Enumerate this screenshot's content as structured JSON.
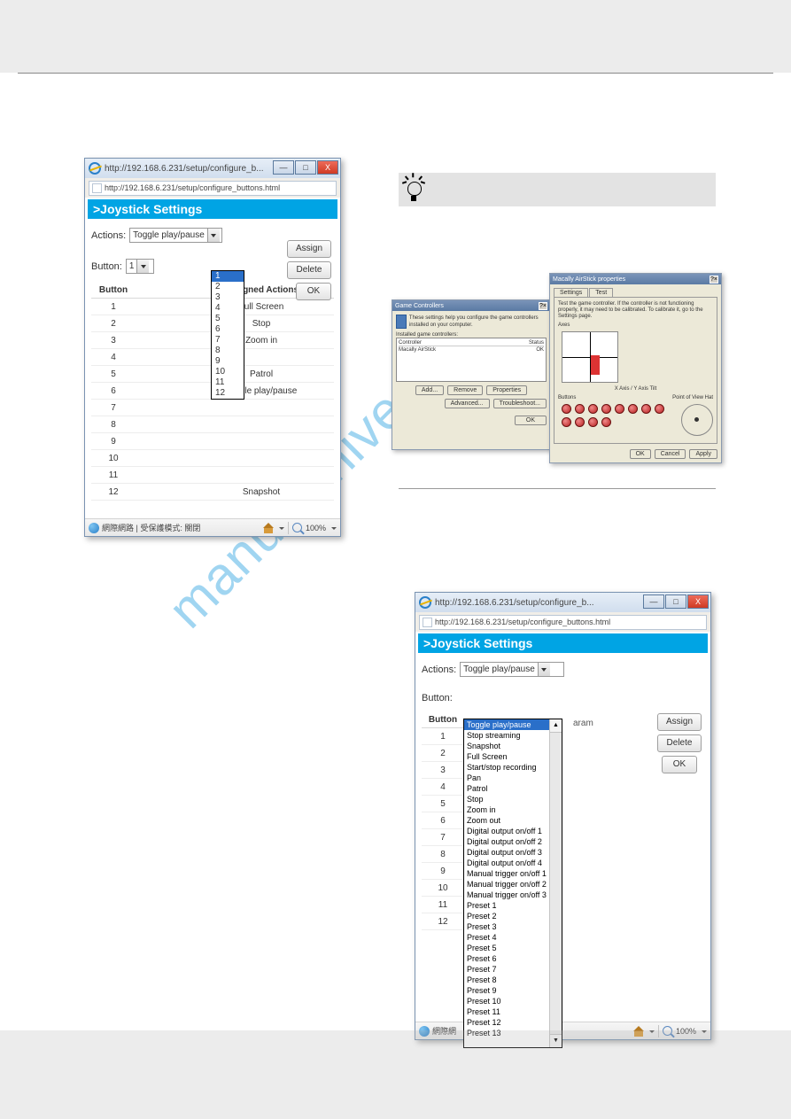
{
  "watermark": "manualshive.com",
  "tip_label": "",
  "window1": {
    "title_url": "http://192.168.6.231/setup/configure_b...",
    "addr_url": "http://192.168.6.231/setup/configure_buttons.html",
    "section_title": ">Joystick Settings",
    "actions_label": "Actions:",
    "actions_value": "Toggle play/pause",
    "button_label": "Button:",
    "button_value": "1",
    "assign_btn": "Assign",
    "delete_btn": "Delete",
    "ok_btn": "OK",
    "col_button": "Button",
    "col_actions": "Assigned Actions",
    "dropdown_numbers": [
      "1",
      "2",
      "3",
      "4",
      "5",
      "6",
      "7",
      "8",
      "9",
      "10",
      "11",
      "12"
    ],
    "rows": [
      {
        "b": "1",
        "a": "Full Screen"
      },
      {
        "b": "2",
        "a": "Stop"
      },
      {
        "b": "3",
        "a": "Zoom in"
      },
      {
        "b": "4",
        "a": ""
      },
      {
        "b": "5",
        "a": "Patrol"
      },
      {
        "b": "6",
        "a": "Toggle play/pause"
      },
      {
        "b": "7",
        "a": ""
      },
      {
        "b": "8",
        "a": ""
      },
      {
        "b": "9",
        "a": ""
      },
      {
        "b": "10",
        "a": ""
      },
      {
        "b": "11",
        "a": ""
      },
      {
        "b": "12",
        "a": "Snapshot"
      }
    ],
    "status_text": "網際網路 | 受保護模式: 關閉",
    "zoom": "100%"
  },
  "window2": {
    "title_url": "http://192.168.6.231/setup/configure_b...",
    "addr_url": "http://192.168.6.231/setup/configure_buttons.html",
    "section_title": ">Joystick Settings",
    "actions_label": "Actions:",
    "actions_value": "Toggle play/pause",
    "partial_word": "aram",
    "button_label": "Button:",
    "assign_btn": "Assign",
    "delete_btn": "Delete",
    "ok_btn": "OK",
    "col_button": "Button",
    "rows_b": [
      "1",
      "2",
      "3",
      "4",
      "5",
      "6",
      "7",
      "8",
      "9",
      "10",
      "11",
      "12"
    ],
    "actions_list": [
      "Toggle play/pause",
      "Stop streaming",
      "Snapshot",
      "Full Screen",
      "Start/stop recording",
      "Pan",
      "Patrol",
      "Stop",
      "Zoom in",
      "Zoom out",
      "Digital output on/off 1",
      "Digital output on/off 2",
      "Digital output on/off 3",
      "Digital output on/off 4",
      "Manual trigger on/off 1",
      "Manual trigger on/off 2",
      "Manual trigger on/off 3",
      "Preset 1",
      "Preset 2",
      "Preset 3",
      "Preset 4",
      "Preset 5",
      "Preset 6",
      "Preset 7",
      "Preset 8",
      "Preset 9",
      "Preset 10",
      "Preset 11",
      "Preset 12",
      "Preset 13"
    ],
    "status_text": "網際網",
    "zoom": "100%"
  },
  "dialog1": {
    "title": "Game Controllers",
    "hint": "These settings help you configure the game controllers installed on your computer.",
    "list_hdr": "Installed game controllers:",
    "list_col1": "Controller",
    "list_col2": "Status",
    "list_item": "Macally AirStick",
    "list_status": "OK",
    "add_btn": "Add...",
    "remove_btn": "Remove",
    "props_btn": "Properties",
    "adv_btn": "Advanced...",
    "trouble_btn": "Troubleshoot...",
    "ok_btn": "OK"
  },
  "dialog2": {
    "title": "Macally AirStick properties",
    "tab1": "Settings",
    "tab2": "Test",
    "hint": "Test the game controller. If the controller is not functioning properly, it may need to be calibrated. To calibrate it, go to the Settings page.",
    "axes_label": "Axes",
    "xy_label": "X Axis / Y Axis   Tilt",
    "buttons_label": "Buttons",
    "pov_label": "Point of View Hat",
    "ok_btn": "OK",
    "cancel_btn": "Cancel",
    "apply_btn": "Apply"
  }
}
